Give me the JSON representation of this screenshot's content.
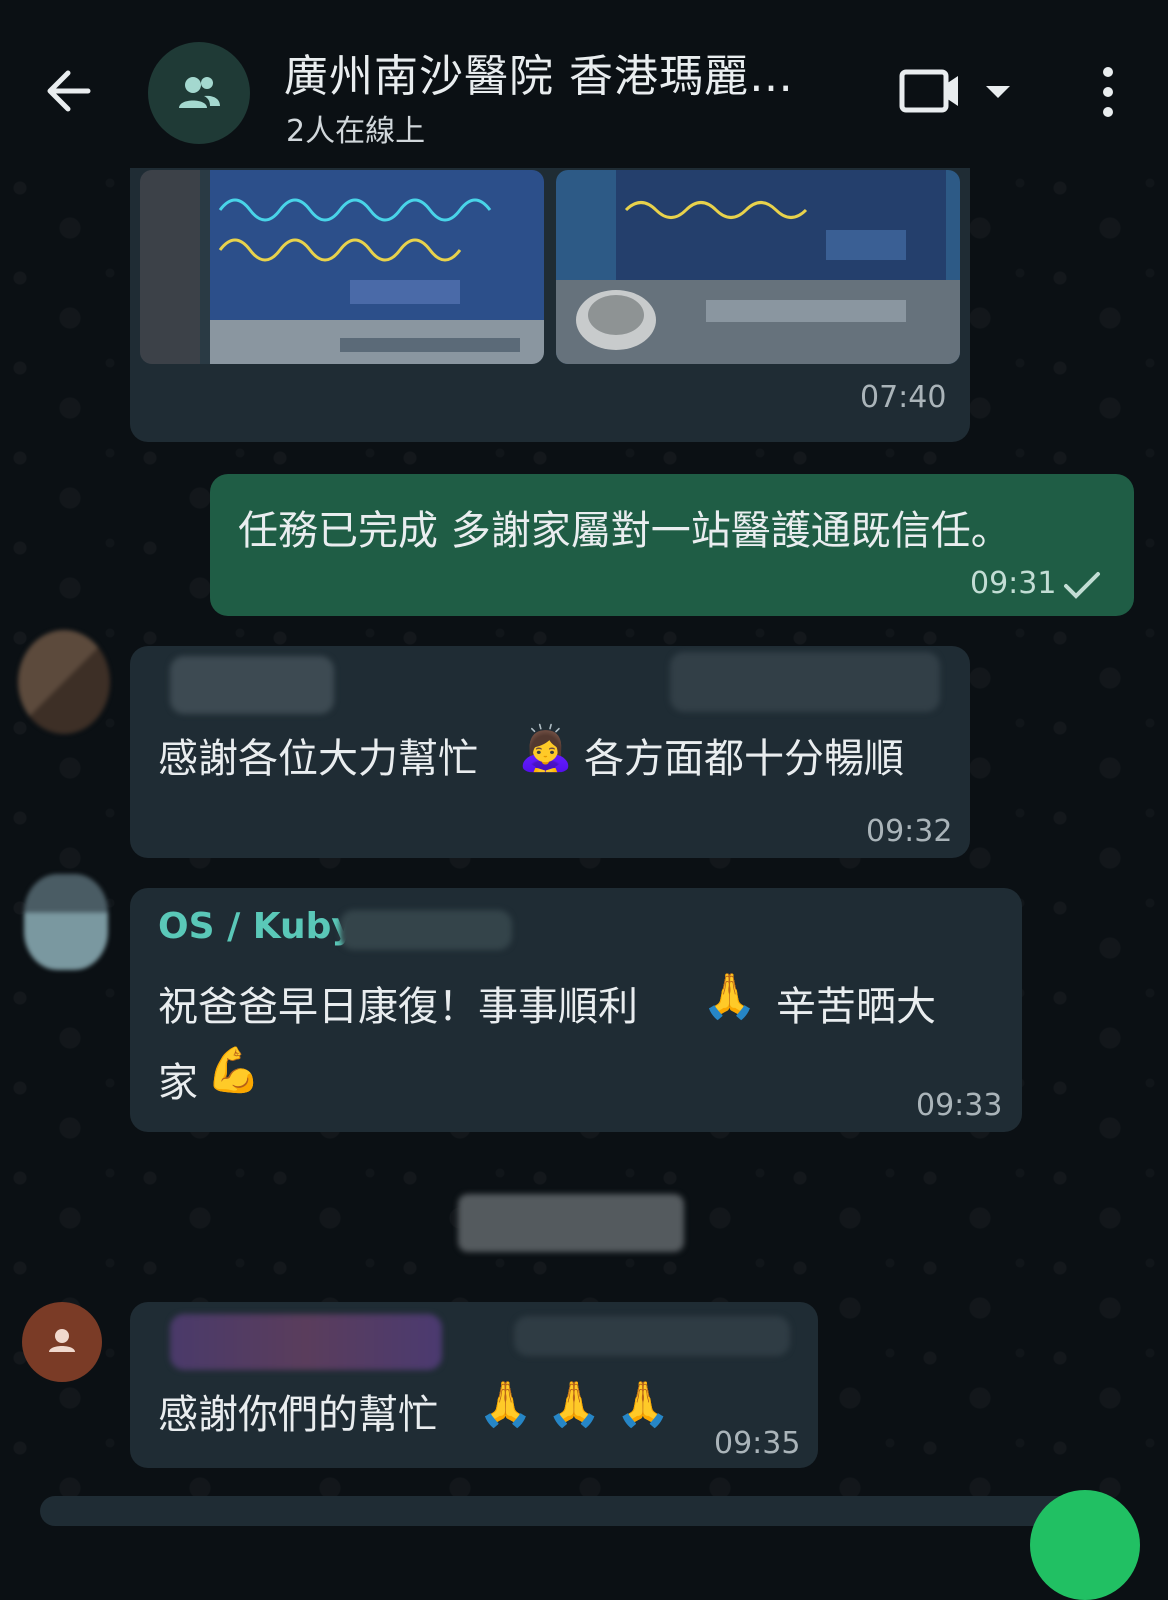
{
  "header": {
    "title": "廣州南沙醫院 香港瑪麗…",
    "subtitle": "2人在線上"
  },
  "messages": [
    {
      "time": "07:40"
    },
    {
      "text": "任務已完成 多謝家屬對一站醫護通既信任。",
      "time": "09:31"
    },
    {
      "text_before": "感謝各位大力幫忙",
      "emoji": "🙇‍♀️",
      "text_after": "各方面都十分暢順",
      "time": "09:32"
    },
    {
      "sender": "OS / Kuby",
      "line1": "祝爸爸早日康復！事事順利",
      "emoji1": "🙏",
      "line1b": "辛苦晒大",
      "line2": "家",
      "emoji2": "💪",
      "time": "09:33"
    },
    {
      "text": "感謝你們的幫忙",
      "emoji": "🙏🙏🙏",
      "time": "09:35"
    }
  ],
  "colors": {
    "background": "#0b1014",
    "bubble_in": "#1f2c34",
    "bubble_out": "#1f5d45",
    "sender_name": "#53bdeb"
  }
}
